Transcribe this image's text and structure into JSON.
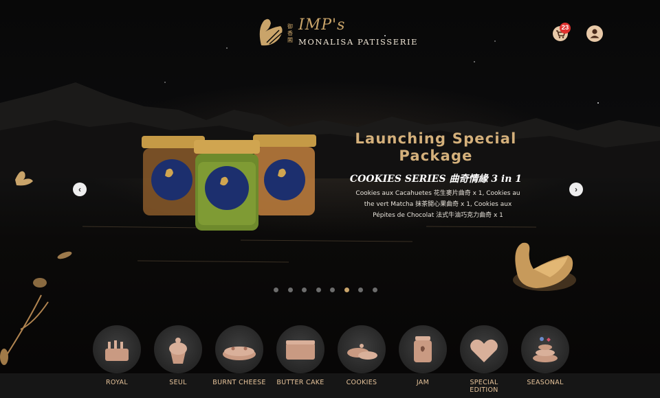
{
  "brand": {
    "script": "IMP's",
    "name": "MONALISA PATISSERIE",
    "cn": "御香閣"
  },
  "header": {
    "cart_count": "23",
    "cart_icon": "cart-icon",
    "user_icon": "user-icon"
  },
  "hero": {
    "title": "Launching Special Package",
    "subtitle": "COOKIES SERIES 曲奇情緣 3 in 1",
    "description": "Cookies aux Cacahuetes 花生麥片曲奇 x 1, Cookies au the vert Matcha 抹茶開心果曲奇 x 1, Cookies aux Pépites de Chocolat 法式牛油巧克力曲奇 x 1",
    "prev_label": "‹",
    "next_label": "›"
  },
  "carousel": {
    "count": 8,
    "active_index": 5
  },
  "categories": [
    {
      "label": "ROYAL",
      "icon": "royal-cake-icon"
    },
    {
      "label": "SEUL",
      "icon": "cupcake-icon"
    },
    {
      "label": "BURNT CHEESE",
      "icon": "burnt-cheese-icon"
    },
    {
      "label": "BUTTER CAKE",
      "icon": "butter-cake-icon"
    },
    {
      "label": "COOKIES",
      "icon": "cookies-icon"
    },
    {
      "label": "JAM",
      "icon": "jam-jar-icon"
    },
    {
      "label": "SPECIAL EDITION",
      "icon": "heart-icon"
    },
    {
      "label": "SEASONAL",
      "icon": "seasonal-cake-icon"
    }
  ],
  "colors": {
    "gold": "#c9a46a",
    "copper": "#e6c39a",
    "badge": "#e0312f"
  }
}
